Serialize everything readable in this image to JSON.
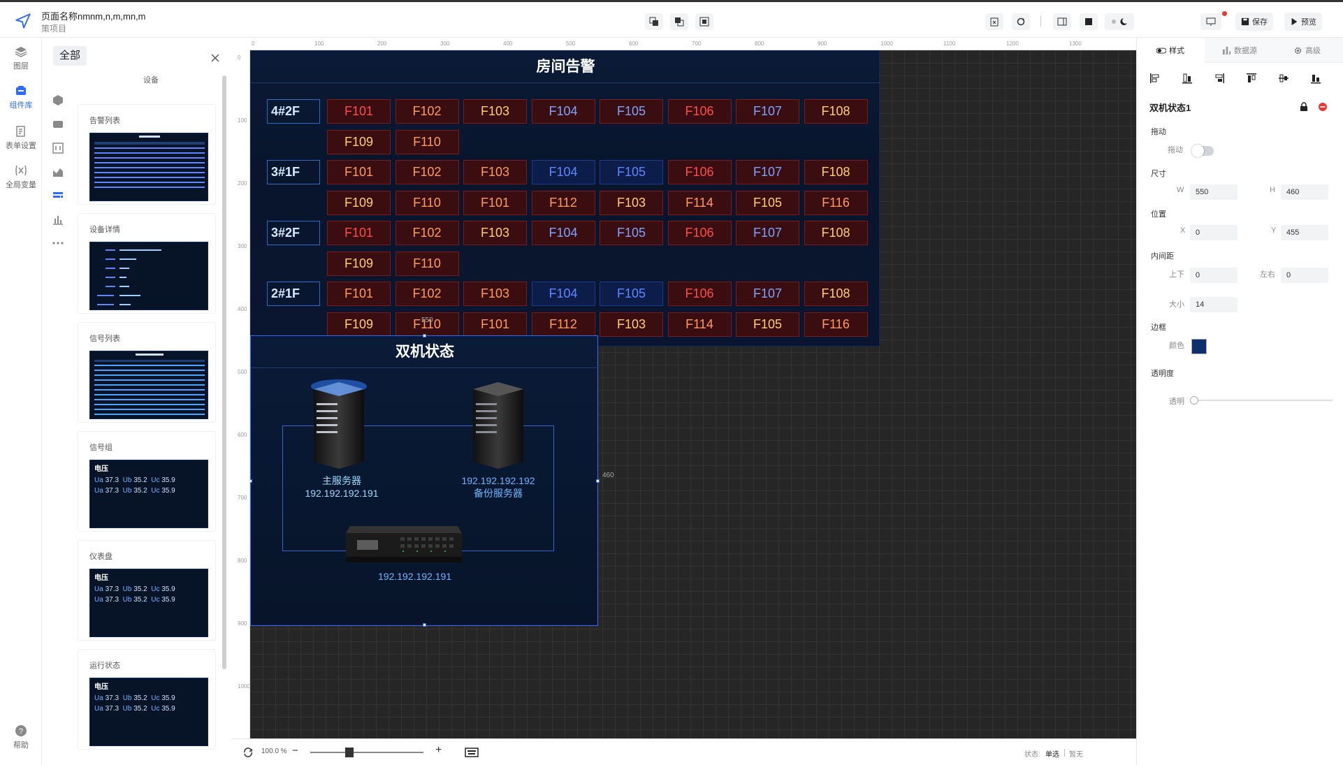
{
  "header": {
    "page_name": "页面名称nmnm,n,m,mn,m",
    "project": "策项目",
    "save_label": "保存",
    "preview_label": "预览"
  },
  "left_rail": {
    "items": [
      {
        "label": "图层",
        "icon": "layers-icon"
      },
      {
        "label": "组件库",
        "icon": "component-library-icon",
        "active": true
      },
      {
        "label": "表单设置",
        "icon": "form-settings-icon"
      },
      {
        "label": "全局变量",
        "icon": "global-variable-icon"
      }
    ],
    "help_label": "帮助"
  },
  "component_panel": {
    "all_tab": "全部",
    "category": "设备",
    "cards": [
      {
        "name": "告警列表"
      },
      {
        "name": "设备详情"
      },
      {
        "name": "信号列表"
      },
      {
        "name": "信号组",
        "thumb_title": "电压"
      },
      {
        "name": "仪表盘",
        "thumb_title": "电压"
      },
      {
        "name": "运行状态",
        "thumb_title": "电压"
      }
    ],
    "thumb_values": {
      "ua": "37.3",
      "ub": "35.2",
      "uc": "35.9",
      "ua_label": "Ua",
      "ub_label": "Ub",
      "uc_label": "Uc"
    }
  },
  "ruler": {
    "top_ticks": [
      "0",
      "100",
      "200",
      "300",
      "400",
      "500",
      "600",
      "700",
      "800",
      "900",
      "1000",
      "1100",
      "1200",
      "1300"
    ],
    "left_ticks": [
      "0",
      "100",
      "200",
      "300",
      "400",
      "500",
      "600",
      "700",
      "800",
      "900",
      "1000"
    ]
  },
  "room_alarm": {
    "title": "房间告警",
    "floors": [
      {
        "label": "4#2F",
        "rows": [
          [
            {
              "t": "F101",
              "c": "red"
            },
            {
              "t": "F102",
              "c": "orange"
            },
            {
              "t": "F103",
              "c": "yellow"
            },
            {
              "t": "F104",
              "c": "pinkb"
            },
            {
              "t": "F105",
              "c": "pinkb"
            },
            {
              "t": "F106",
              "c": "red"
            },
            {
              "t": "F107",
              "c": "pinkb"
            },
            {
              "t": "F108",
              "c": "yellow"
            }
          ],
          [
            {
              "t": "F109",
              "c": "yellow"
            },
            {
              "t": "F110",
              "c": "orange"
            }
          ]
        ]
      },
      {
        "label": "3#1F",
        "rows": [
          [
            {
              "t": "F101",
              "c": "orange"
            },
            {
              "t": "F102",
              "c": "orange"
            },
            {
              "t": "F103",
              "c": "orange"
            },
            {
              "t": "F104",
              "c": "blue"
            },
            {
              "t": "F105",
              "c": "blue"
            },
            {
              "t": "F106",
              "c": "red"
            },
            {
              "t": "F107",
              "c": "pinkb"
            },
            {
              "t": "F108",
              "c": "yellow"
            }
          ],
          [
            {
              "t": "F109",
              "c": "yellow"
            },
            {
              "t": "F110",
              "c": "orange"
            },
            {
              "t": "F101",
              "c": "orange"
            },
            {
              "t": "F112",
              "c": "orange"
            },
            {
              "t": "F103",
              "c": "yellow"
            },
            {
              "t": "F114",
              "c": "orange"
            },
            {
              "t": "F105",
              "c": "yellow"
            },
            {
              "t": "F116",
              "c": "orange"
            }
          ]
        ]
      },
      {
        "label": "3#2F",
        "rows": [
          [
            {
              "t": "F101",
              "c": "red"
            },
            {
              "t": "F102",
              "c": "orange"
            },
            {
              "t": "F103",
              "c": "yellow"
            },
            {
              "t": "F104",
              "c": "pinkb"
            },
            {
              "t": "F105",
              "c": "pinkb"
            },
            {
              "t": "F106",
              "c": "red"
            },
            {
              "t": "F107",
              "c": "pinkb"
            },
            {
              "t": "F108",
              "c": "yellow"
            }
          ],
          [
            {
              "t": "F109",
              "c": "yellow"
            },
            {
              "t": "F110",
              "c": "orange"
            }
          ]
        ]
      },
      {
        "label": "2#1F",
        "rows": [
          [
            {
              "t": "F101",
              "c": "orange"
            },
            {
              "t": "F102",
              "c": "orange"
            },
            {
              "t": "F103",
              "c": "orange"
            },
            {
              "t": "F104",
              "c": "blue"
            },
            {
              "t": "F105",
              "c": "blue"
            },
            {
              "t": "F106",
              "c": "red"
            },
            {
              "t": "F107",
              "c": "pinkb"
            },
            {
              "t": "F108",
              "c": "yellow"
            }
          ],
          [
            {
              "t": "F109",
              "c": "yellow"
            },
            {
              "t": "F110",
              "c": "orange"
            },
            {
              "t": "F101",
              "c": "orange"
            },
            {
              "t": "F112",
              "c": "orange"
            },
            {
              "t": "F103",
              "c": "yellow"
            },
            {
              "t": "F114",
              "c": "orange"
            },
            {
              "t": "F105",
              "c": "yellow"
            },
            {
              "t": "F116",
              "c": "orange"
            }
          ]
        ]
      }
    ]
  },
  "dual_status": {
    "title": "双机状态",
    "main_server_label": "主服务器",
    "main_server_ip": "192.192.192.191",
    "backup_server_ip": "192.192.192.192",
    "backup_server_label": "备份服务器",
    "switch_ip": "192.192.192.191",
    "width_marker": "550",
    "height_marker": "460"
  },
  "properties": {
    "tabs": [
      "样式",
      "数据源",
      "高级"
    ],
    "component_name": "双机状态1",
    "drag_section": "拖动",
    "drag_label": "拖动",
    "size_section": "尺寸",
    "w_label": "W",
    "w_value": "550",
    "h_label": "H",
    "h_value": "460",
    "position_section": "位置",
    "x_label": "X",
    "x_value": "0",
    "y_label": "Y",
    "y_value": "455",
    "padding_section": "内间距",
    "pad_tb_label": "上下",
    "pad_tb_value": "0",
    "pad_lr_label": "左右",
    "pad_lr_value": "0",
    "size_label": "大小",
    "size_value": "14",
    "border_section": "边框",
    "color_label": "颜色",
    "border_color": "#0f2f6b",
    "opacity_section": "透明度",
    "opacity_label": "透明"
  },
  "footer": {
    "zoom": "100.0 %",
    "status_label": "状态:",
    "status_value": "单选",
    "status_extra": "暂无"
  }
}
